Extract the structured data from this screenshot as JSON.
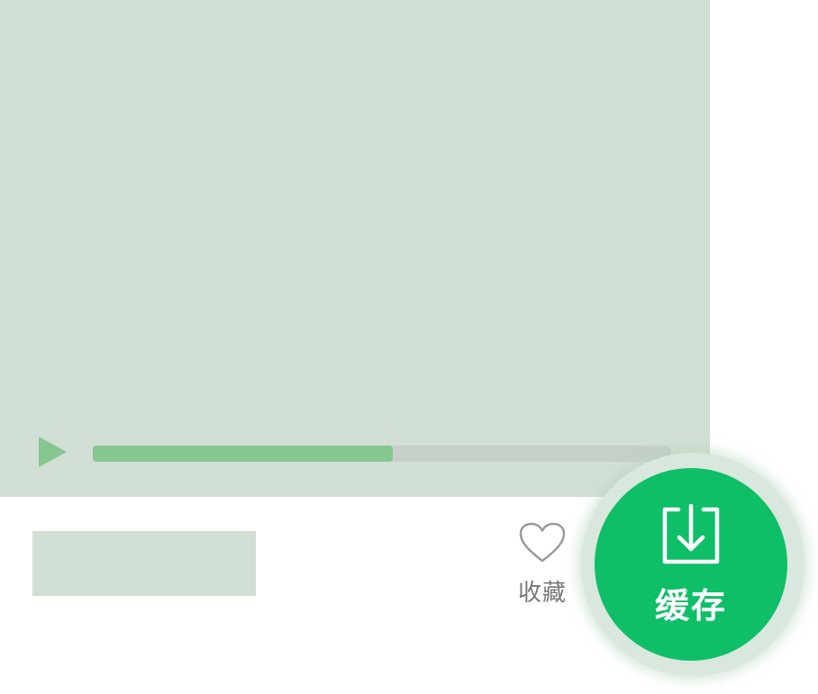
{
  "player": {
    "play_icon": "play-icon",
    "progress_value": 0.52,
    "progress_color": "#86c690",
    "track_color": "#c7cfc9",
    "video_bg_color": "#d2dfd5"
  },
  "actions": {
    "favorite": {
      "icon": "heart-icon",
      "label": "收藏"
    },
    "cache": {
      "icon": "download-icon",
      "label": "缓存",
      "color": "#0ebf68"
    }
  }
}
